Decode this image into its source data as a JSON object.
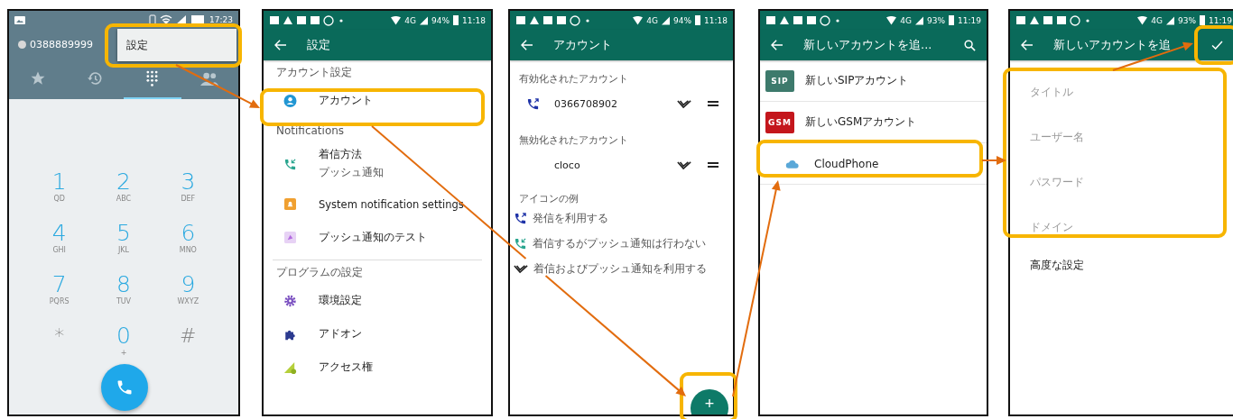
{
  "panels": [
    {
      "kind": "dialer",
      "status": {
        "time": "17:23"
      },
      "number": "0388889999",
      "menu_item": "設定",
      "tabs": [
        {
          "kind": "favorites",
          "selected": false
        },
        {
          "kind": "history",
          "selected": false
        },
        {
          "kind": "dialpad",
          "selected": true
        },
        {
          "kind": "contacts",
          "selected": false
        }
      ],
      "keys": [
        {
          "digit": "1",
          "letters": "QD"
        },
        {
          "digit": "2",
          "letters": "ABC"
        },
        {
          "digit": "3",
          "letters": "DEF"
        },
        {
          "digit": "4",
          "letters": "GHI"
        },
        {
          "digit": "5",
          "letters": "JKL"
        },
        {
          "digit": "6",
          "letters": "MNO"
        },
        {
          "digit": "7",
          "letters": "PQRS"
        },
        {
          "digit": "8",
          "letters": "TUV"
        },
        {
          "digit": "9",
          "letters": "WXYZ"
        },
        {
          "digit": "*"
        },
        {
          "digit": "0",
          "letters": "+"
        },
        {
          "digit": "#"
        }
      ]
    },
    {
      "kind": "settings",
      "status": {
        "network": "4G",
        "battery": "94%",
        "time": "11:18"
      },
      "title": "設定",
      "sections": [
        {
          "header": "アカウント設定",
          "items": [
            {
              "kind": "account",
              "label": "アカウント"
            }
          ]
        },
        {
          "header": "Notifications",
          "items": [
            {
              "kind": "incoming",
              "label": "着信方法",
              "sub": "プッシュ通知"
            },
            {
              "kind": "bell",
              "label": "System notification settings"
            },
            {
              "kind": "push-test",
              "label": "プッシュ通知のテスト"
            }
          ]
        },
        {
          "header": "プログラムの設定",
          "items": [
            {
              "kind": "gear",
              "label": "環境設定"
            },
            {
              "kind": "puzzle",
              "label": "アドオン"
            },
            {
              "kind": "access",
              "label": "アクセス権"
            }
          ]
        }
      ]
    },
    {
      "kind": "accounts",
      "status": {
        "network": "4G",
        "battery": "94%",
        "time": "11:18"
      },
      "title": "アカウント",
      "sections": [
        {
          "header": "有効化されたアカウント",
          "items": [
            {
              "kind": "outgoing",
              "name": "0366708902"
            }
          ]
        },
        {
          "header": "無効化されたアカウント",
          "items": [
            {
              "kind": "none",
              "name": "cloco"
            }
          ]
        }
      ],
      "legend_title": "アイコンの例",
      "legend": [
        {
          "kind": "outgoing",
          "label": "発信を利用する"
        },
        {
          "kind": "incoming",
          "label": "着信するがプッシュ通知は行わない"
        },
        {
          "kind": "push",
          "label": "着信およびプッシュ通知を利用する"
        }
      ],
      "fab": "+"
    },
    {
      "kind": "add_account",
      "status": {
        "network": "4G",
        "battery": "93%",
        "time": "11:19"
      },
      "title": "新しいアカウントを追...",
      "items": [
        {
          "kind": "badge",
          "badge": "SIP",
          "color": "#3d7a6c",
          "label": "新しいSIPアカウント"
        },
        {
          "kind": "badge",
          "badge": "GSM",
          "color": "#c4161c",
          "label": "新しいGSMアカウント"
        },
        {
          "kind": "cloud",
          "label": "CloudPhone"
        }
      ]
    },
    {
      "kind": "account_form",
      "status": {
        "network": "4G",
        "battery": "93%",
        "time": "11:19"
      },
      "title": "新しいアカウントを追",
      "fields": [
        {
          "placeholder": "タイトル"
        },
        {
          "placeholder": "ユーザー名"
        },
        {
          "placeholder": "パスワード"
        },
        {
          "placeholder": "ドメイン"
        }
      ],
      "advanced": "高度な設定"
    }
  ]
}
